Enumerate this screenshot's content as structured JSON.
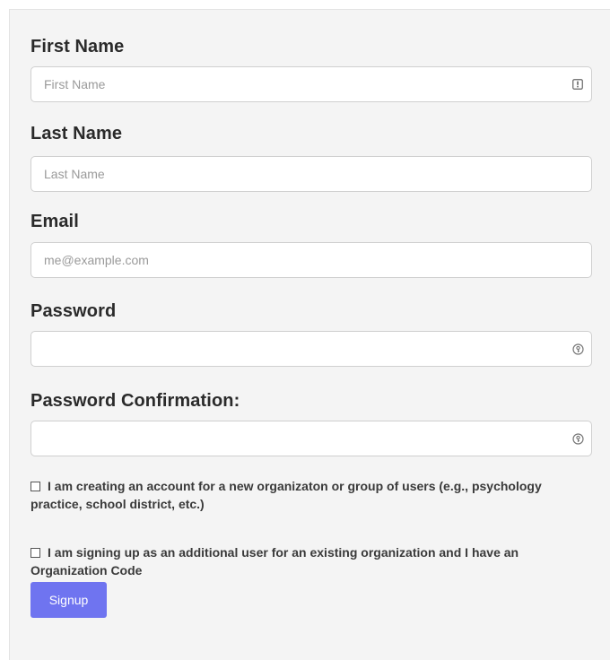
{
  "form": {
    "first_name": {
      "label": "First Name",
      "placeholder": "First Name",
      "value": "",
      "icon": "contact-card-icon"
    },
    "last_name": {
      "label": "Last Name",
      "placeholder": "Last Name",
      "value": ""
    },
    "email": {
      "label": "Email",
      "placeholder": "me@example.com",
      "value": ""
    },
    "password": {
      "label": "Password",
      "placeholder": "",
      "value": "",
      "icon": "key-icon"
    },
    "password_confirmation": {
      "label": "Password Confirmation:",
      "placeholder": "",
      "value": "",
      "icon": "key-icon"
    },
    "new_org_checkbox": {
      "checked": false,
      "label": "I am creating an account for a new organizaton or group of users (e.g., psychology practice, school district, etc.)"
    },
    "existing_org_checkbox": {
      "checked": false,
      "label": "I am signing up as an additional user for an existing organization and I have an Organization Code"
    },
    "signup_button": {
      "label": "Signup"
    }
  },
  "colors": {
    "panel_background": "#f4f4f4",
    "button_background": "#6f74f0",
    "button_text": "#ffffff",
    "label_text": "#2a2a2a"
  }
}
